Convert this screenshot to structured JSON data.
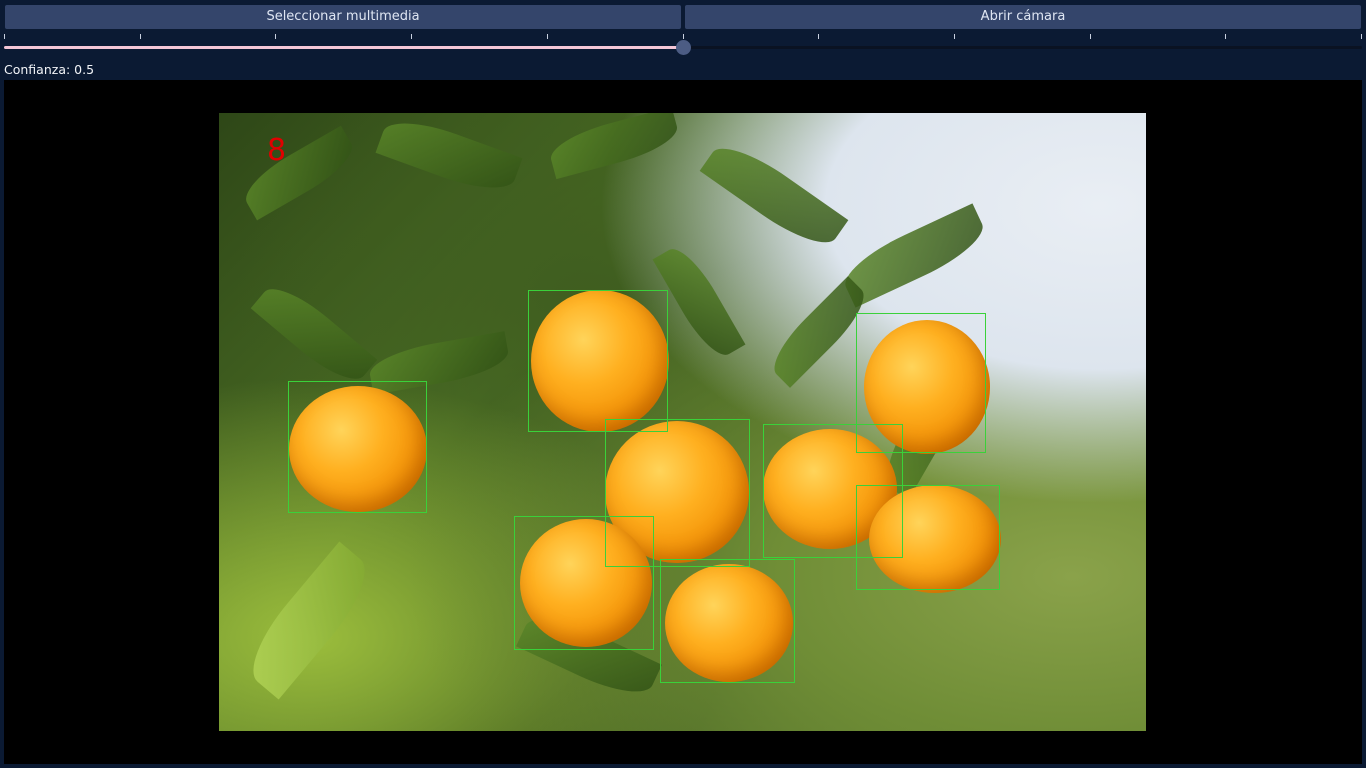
{
  "toolbar": {
    "select_media_label": "Seleccionar multimedia",
    "open_camera_label": "Abrir cámara"
  },
  "confidence": {
    "label": "Confianza: 0.5",
    "value": 0.5,
    "min": 0,
    "max": 1,
    "tick_count": 11
  },
  "detection": {
    "count": "8",
    "box_color": "#3ad13a",
    "count_color": "#e00000"
  },
  "colors": {
    "background": "#0b1a33",
    "button": "#34456b",
    "slider_fill": "#f4c6d7",
    "slider_handle": "#4c5c84"
  }
}
